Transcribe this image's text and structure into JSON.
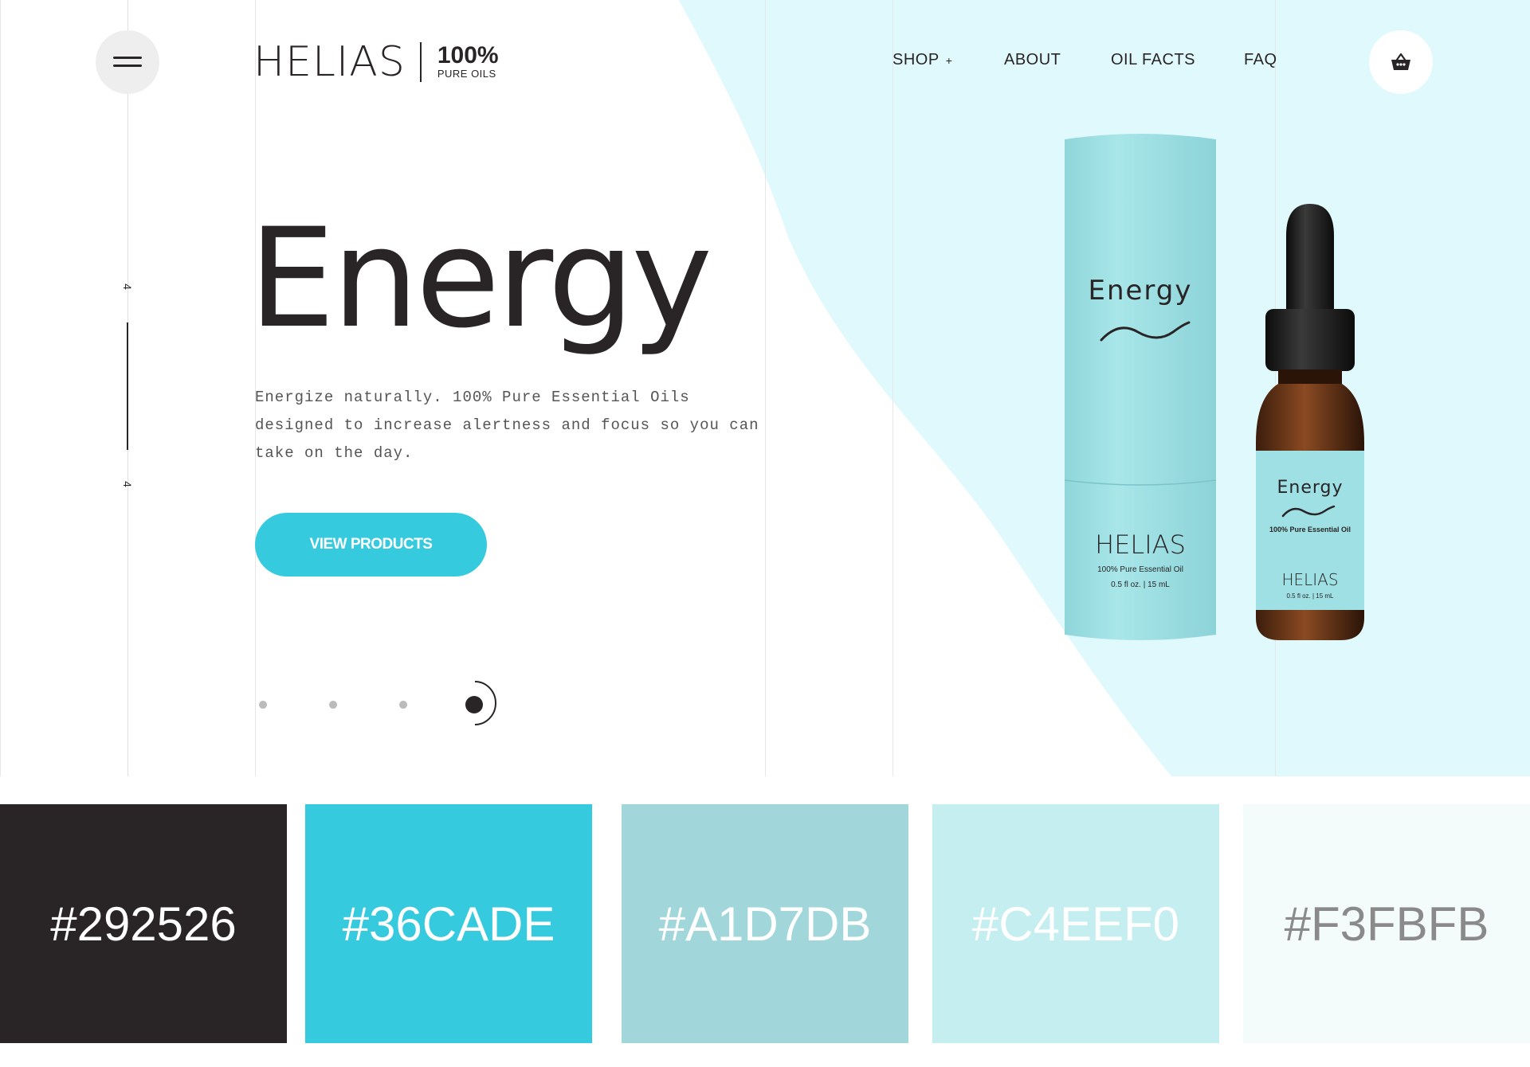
{
  "brand": {
    "name": "HELIAS",
    "percent": "100%",
    "tagline": "PURE OILS"
  },
  "nav": {
    "items": [
      {
        "label": "SHOP",
        "suffix": "+"
      },
      {
        "label": "ABOUT"
      },
      {
        "label": "OIL FACTS"
      },
      {
        "label": "FAQ"
      }
    ]
  },
  "icons": {
    "menu": "hamburger-menu-icon",
    "cart": "basket-icon"
  },
  "slider": {
    "current": "4",
    "total": "4",
    "dots": 4,
    "active_dot": 4
  },
  "hero": {
    "title": "Energy",
    "description": "Energize naturally. 100% Pure Essential Oils designed to increase alertness and focus so you can take on the day.",
    "cta_label": "VIEW PRODUCTS"
  },
  "products": {
    "tube": {
      "name": "Energy",
      "brand": "HELIAS",
      "line1": "100% Pure Essential Oil",
      "line2": "0.5 fl oz. | 15 mL"
    },
    "bottle": {
      "name": "Energy",
      "line1": "100% Pure Essential Oil",
      "brand": "HELIAS",
      "line2": "0.5 fl oz. | 15 mL"
    }
  },
  "palette": [
    {
      "hex": "#292526",
      "text_color": "#ffffff"
    },
    {
      "hex": "#36CADE",
      "text_color": "#ffffff"
    },
    {
      "hex": "#A1D7DB",
      "text_color": "#ffffff"
    },
    {
      "hex": "#C4EEF0",
      "text_color": "#ffffff"
    },
    {
      "hex": "#F3FBFB",
      "text_color": "#8a8a8a"
    }
  ],
  "colors": {
    "accent": "#36CADE",
    "dark": "#292526",
    "hero_panel": "#E0F9FC",
    "product": "#9ee0e4"
  }
}
